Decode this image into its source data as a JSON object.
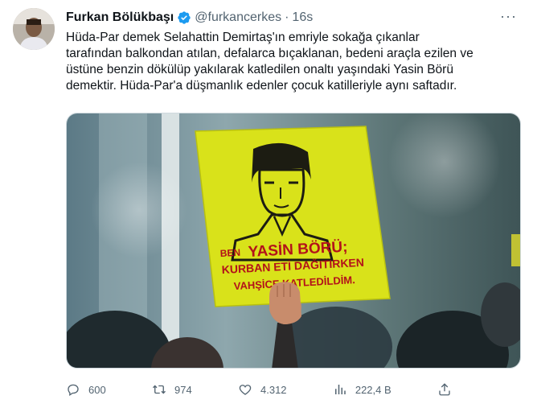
{
  "author": {
    "name": "Furkan Bölükbaşı",
    "handle": "@furkancerkes",
    "separator": "·",
    "time": "16s"
  },
  "tweet": {
    "lines": [
      "Hüda-Par demek Selahattin Demirtaş'ın emriyle sokağa çıkanlar",
      "tarafından balkondan atılan, defalarca bıçaklanan, bedeni araçla ezilen ve",
      "üstüne benzin dökülüp yakılarak katledilen onaltı yaşındaki Yasin Börü",
      "demektir. Hüda-Par'a düşmanlık edenler çocuk katilleriyle aynı saftadır."
    ]
  },
  "media": {
    "sign": {
      "line1_prefix": "BEN",
      "line1_name": "YASİN BÖRÜ;",
      "line2": "KURBAN ETİ DAĞITIRKEN",
      "line3": "VAHŞİCE KATLEDİLDİM."
    }
  },
  "actions": {
    "reply_count": "600",
    "retweet_count": "974",
    "like_count": "4.312",
    "views_count": "222,4 B"
  },
  "more_label": "···",
  "colors": {
    "verified": "#1d9bf0",
    "sign_yellow": "#d9e21a",
    "sign_red": "#b3121a",
    "muted": "#536471"
  },
  "icons": [
    "verified-badge-icon",
    "more-icon",
    "reply-icon",
    "retweet-icon",
    "like-icon",
    "views-icon",
    "share-icon"
  ]
}
